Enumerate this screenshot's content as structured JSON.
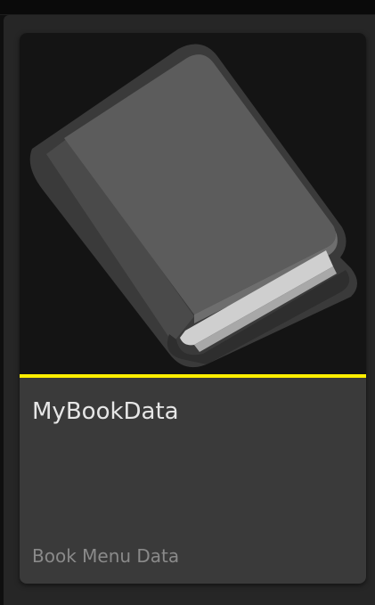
{
  "asset_card": {
    "title": "MyBookData",
    "type_label": "Book Menu Data",
    "icon": "book-icon",
    "accent_color": "#ffee00"
  }
}
